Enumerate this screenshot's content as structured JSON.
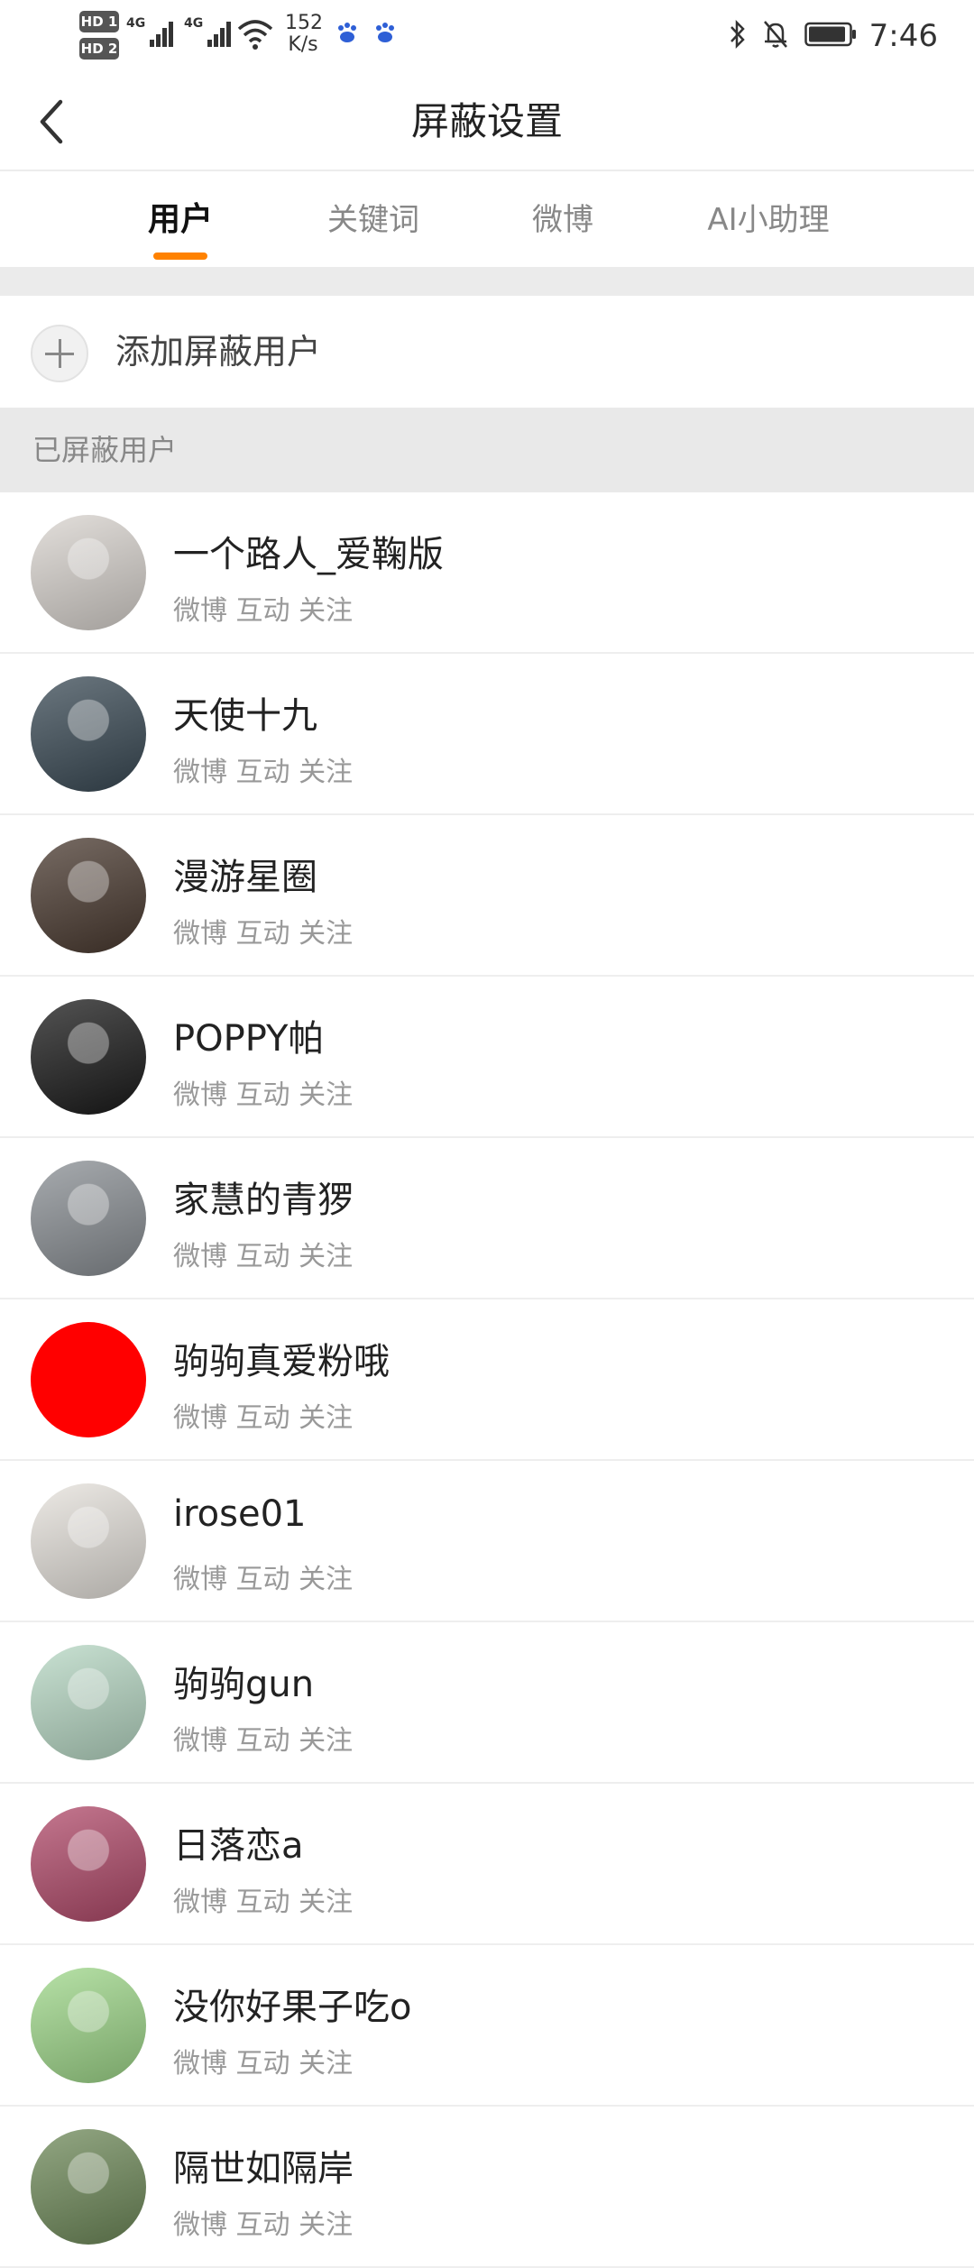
{
  "status_bar": {
    "hd1": "HD 1",
    "hd2": "HD 2",
    "net1": "4G",
    "net2": "4G",
    "speed_value": "152",
    "speed_unit": "K/s",
    "time": "7:46",
    "icons": [
      "hd-icon",
      "signal-icon",
      "wifi-icon",
      "baidu-paw-icon",
      "bluetooth-icon",
      "mute-icon",
      "battery-icon"
    ]
  },
  "header": {
    "title": "屏蔽设置",
    "back_icon": "chevron-left-icon"
  },
  "tabs": [
    {
      "label": "用户",
      "active": true
    },
    {
      "label": "关键词",
      "active": false
    },
    {
      "label": "微博",
      "active": false
    },
    {
      "label": "AI小助理",
      "active": false
    }
  ],
  "accent_color": "#ff8200",
  "add_blocked_user": {
    "label": "添加屏蔽用户",
    "icon": "plus-icon"
  },
  "section": {
    "title": "已屏蔽用户"
  },
  "users": [
    {
      "name": "一个路人_爱鞠版",
      "tags": "微博 互动 关注",
      "avatar_color": "#d9d4cf"
    },
    {
      "name": "天使十九",
      "tags": "微博 互动 关注",
      "avatar_color": "#3a4a55"
    },
    {
      "name": "漫游星圈",
      "tags": "微博 互动 关注",
      "avatar_color": "#4a3a30"
    },
    {
      "name": "POPPY帕",
      "tags": "微博 互动 关注",
      "avatar_color": "#1a1a1a"
    },
    {
      "name": "家慧的青猡",
      "tags": "微博 互动 关注",
      "avatar_color": "#8a8f94"
    },
    {
      "name": "驹驹真爱粉哦",
      "tags": "微博 互动 关注",
      "avatar_color": "#ff0000"
    },
    {
      "name": "irose01",
      "tags": "微博 互动 关注",
      "avatar_color": "#e6e2dc"
    },
    {
      "name": "驹驹gun",
      "tags": "微博 互动 关注",
      "avatar_color": "#b7d8c4"
    },
    {
      "name": "日落恋a",
      "tags": "微博 互动 关注",
      "avatar_color": "#b14a6a"
    },
    {
      "name": "没你好果子吃o",
      "tags": "微博 互动 关注",
      "avatar_color": "#9fd88a"
    },
    {
      "name": "隔世如隔岸",
      "tags": "微博 互动 关注",
      "avatar_color": "#6f8a5a"
    }
  ]
}
